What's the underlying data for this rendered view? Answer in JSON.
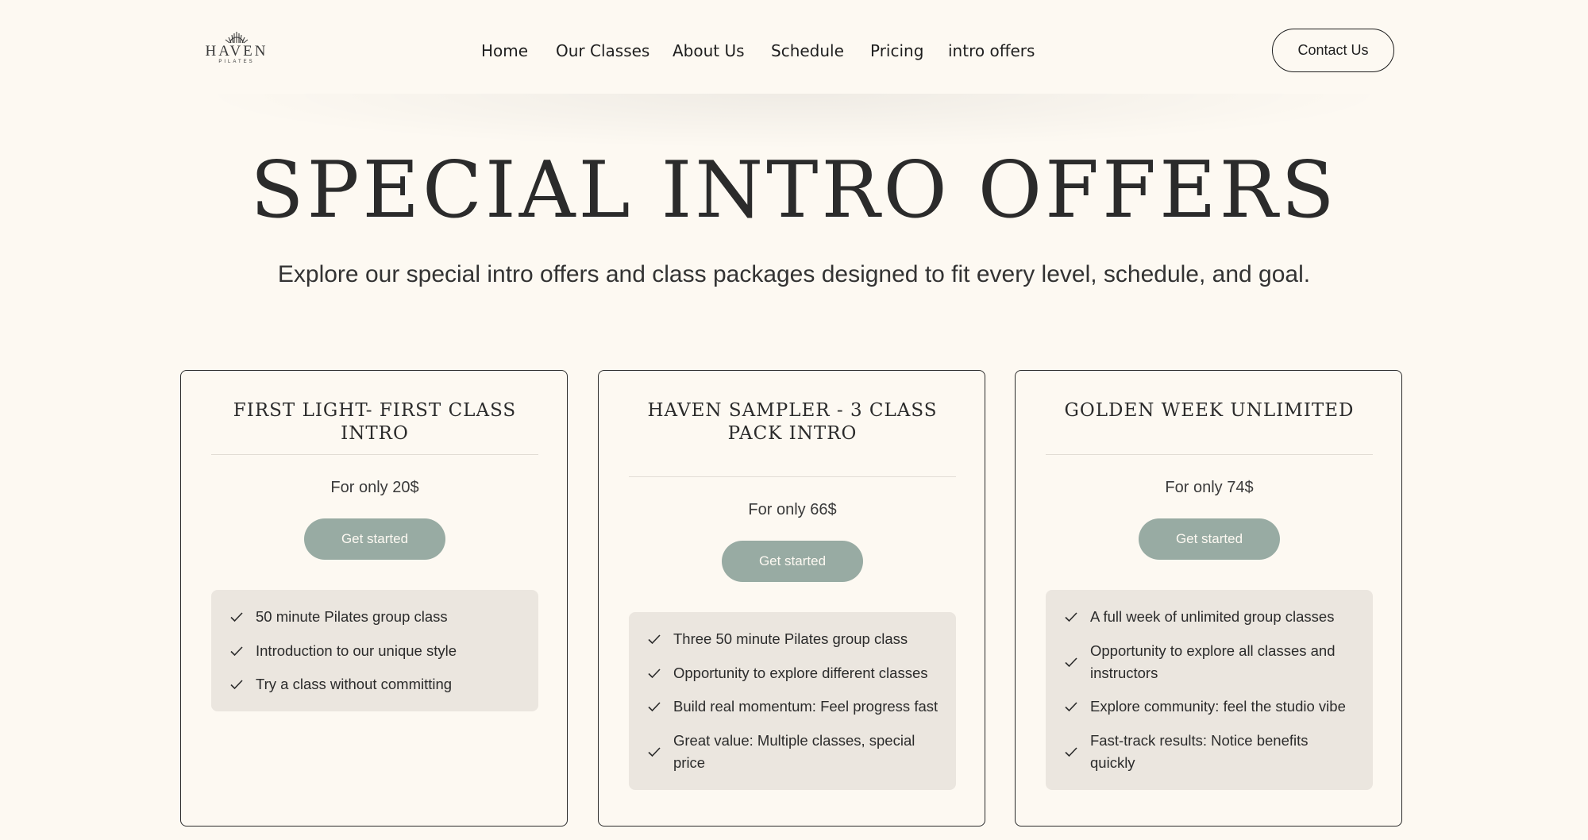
{
  "logo": {
    "wordmark": "HAVEN",
    "subtext": "PILATES"
  },
  "nav": {
    "items": [
      {
        "label": "Home"
      },
      {
        "label": "Our Classes"
      },
      {
        "label": "About Us"
      },
      {
        "label": "Schedule"
      },
      {
        "label": "Pricing"
      },
      {
        "label": "intro offers"
      }
    ],
    "contact_label": "Contact Us"
  },
  "hero": {
    "title": "SPECIAL INTRO OFFERS",
    "subtitle": "Explore our special intro offers and class packages designed to fit every level, schedule, and goal."
  },
  "colors": {
    "background": "#fdf9f2",
    "button": "#98aba3",
    "feature_box": "#ebe6df",
    "text": "#2b2b2b"
  },
  "cards": [
    {
      "title": "FIRST LIGHT- FIRST CLASS INTRO",
      "price": "For only 20$",
      "button_label": "Get started",
      "features": [
        "50 minute Pilates group class",
        "Introduction to our unique style",
        "Try a class without committing"
      ]
    },
    {
      "title": "HAVEN SAMPLER - 3 CLASS PACK INTRO",
      "price": "For only 66$",
      "button_label": "Get started",
      "features": [
        "Three 50 minute Pilates group class",
        "Opportunity to explore different classes",
        "Build real momentum: Feel progress fast",
        "Great value: Multiple classes, special price"
      ]
    },
    {
      "title": "GOLDEN WEEK UNLIMITED",
      "price": "For only 74$",
      "button_label": "Get started",
      "features": [
        "A full week of unlimited group classes",
        "Opportunity to explore all classes and instructors",
        "Explore community: feel the studio vibe",
        "Fast-track results: Notice benefits quickly"
      ]
    }
  ]
}
